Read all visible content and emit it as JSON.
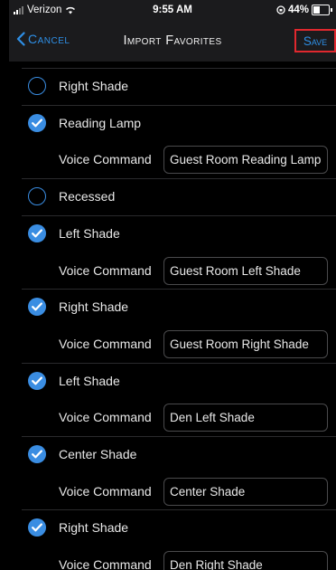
{
  "status_bar": {
    "carrier": "Verizon",
    "time": "9:55 AM",
    "battery": "44%",
    "battery_level": 0.44
  },
  "nav": {
    "cancel_label": "Cancel",
    "title": "Import Favorites",
    "save_label": "Save",
    "accent_color": "#2e8fe6",
    "highlight_color": "#e0282e"
  },
  "items": [
    {
      "label": "Right Shade",
      "checked": false
    },
    {
      "label": "Reading Lamp",
      "checked": true,
      "voice_label": "Voice Command",
      "voice_value": "Guest Room Reading Lamp"
    },
    {
      "label": "Recessed",
      "checked": false
    },
    {
      "label": "Left Shade",
      "checked": true,
      "voice_label": "Voice Command",
      "voice_value": "Guest Room Left Shade"
    },
    {
      "label": "Right Shade",
      "checked": true,
      "voice_label": "Voice Command",
      "voice_value": "Guest Room Right Shade"
    },
    {
      "label": "Left Shade",
      "checked": true,
      "voice_label": "Voice Command",
      "voice_value": "Den Left Shade"
    },
    {
      "label": "Center Shade",
      "checked": true,
      "voice_label": "Voice Command",
      "voice_value": "Center Shade"
    },
    {
      "label": "Right Shade",
      "checked": true,
      "voice_label": "Voice Command",
      "voice_value": "Den Right Shade"
    }
  ]
}
